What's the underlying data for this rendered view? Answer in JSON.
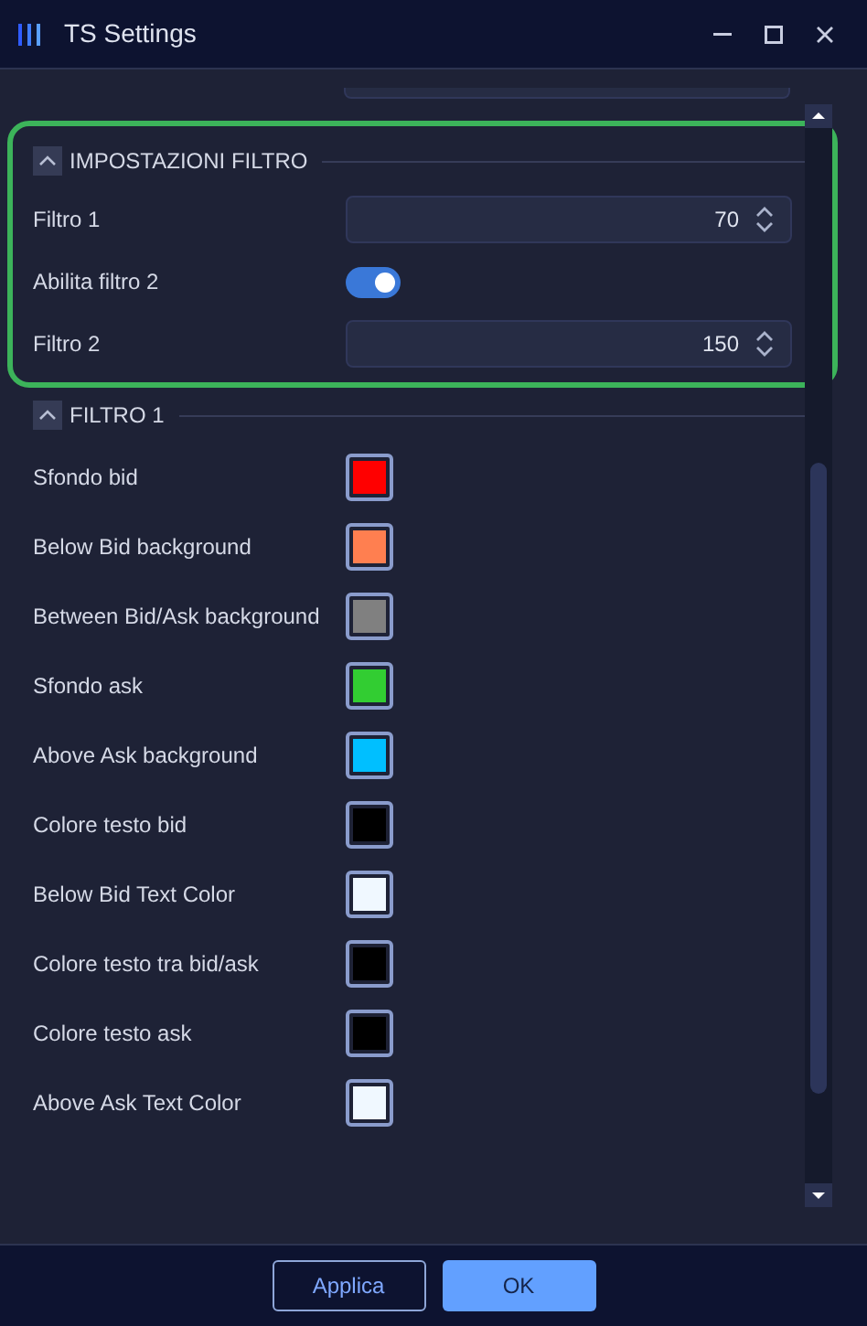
{
  "window": {
    "title": "TS Settings"
  },
  "sections": [
    {
      "title": "IMPOSTAZIONI FILTRO",
      "expanded": true,
      "highlighted": true,
      "rows": [
        {
          "kind": "number",
          "label": "Filtro 1",
          "value": "70"
        },
        {
          "kind": "toggle",
          "label": "Abilita filtro 2",
          "on": true
        },
        {
          "kind": "number",
          "label": "Filtro 2",
          "value": "150"
        }
      ]
    },
    {
      "title": "FILTRO 1",
      "expanded": true,
      "highlighted": false,
      "rows": [
        {
          "kind": "color",
          "label": "Sfondo bid",
          "color": "#ff0000"
        },
        {
          "kind": "color",
          "label": "Below Bid background",
          "color": "#ff7f50"
        },
        {
          "kind": "color",
          "label": "Between Bid/Ask background",
          "color": "#808080"
        },
        {
          "kind": "color",
          "label": "Sfondo ask",
          "color": "#32cd32"
        },
        {
          "kind": "color",
          "label": "Above Ask background",
          "color": "#00bfff"
        },
        {
          "kind": "color",
          "label": "Colore testo bid",
          "color": "#000000"
        },
        {
          "kind": "color",
          "label": "Below Bid Text Color",
          "color": "#f0f8ff"
        },
        {
          "kind": "color",
          "label": "Colore testo tra bid/ask",
          "color": "#000000"
        },
        {
          "kind": "color",
          "label": "Colore testo ask",
          "color": "#000000"
        },
        {
          "kind": "color",
          "label": "Above Ask Text Color",
          "color": "#f0f8ff"
        }
      ]
    }
  ],
  "buttons": [
    {
      "label": "Applica",
      "primary": false
    },
    {
      "label": "OK",
      "primary": true
    }
  ]
}
